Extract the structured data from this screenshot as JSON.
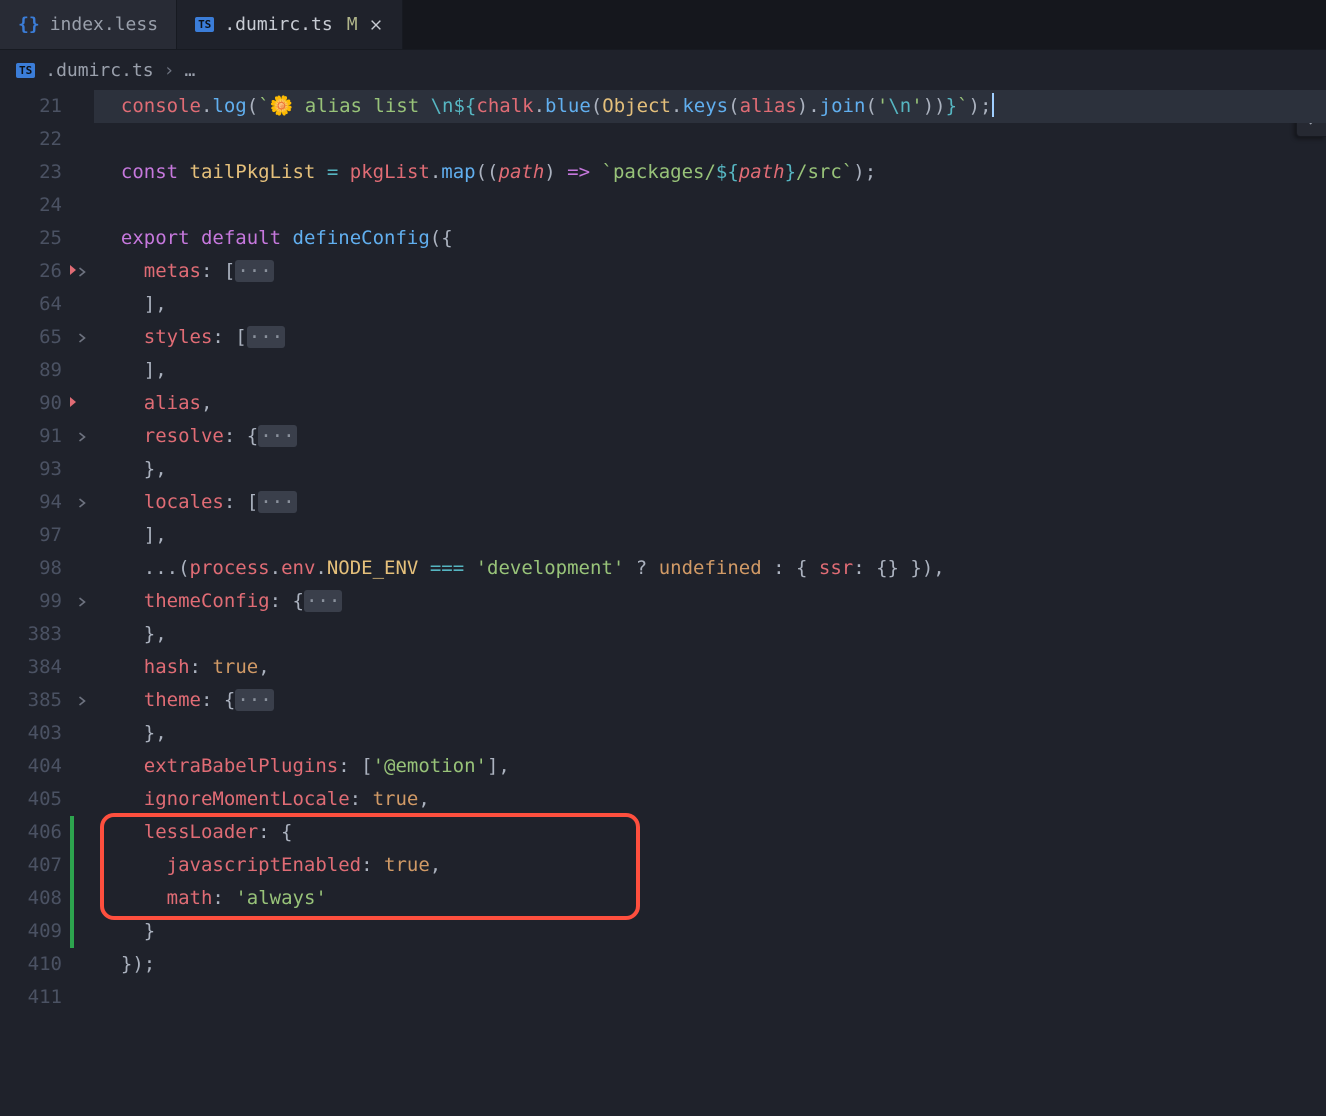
{
  "tabs": [
    {
      "name": "index.less",
      "icon": "braces",
      "modified": false,
      "active": false
    },
    {
      "name": ".dumirc.ts",
      "icon": "ts",
      "modified": true,
      "active": true
    }
  ],
  "breadcrumb": {
    "file": ".dumirc.ts",
    "trail": "…"
  },
  "annotation": {
    "present": true
  },
  "lines": [
    {
      "no": "21",
      "fold": "",
      "marker": "",
      "added": false,
      "tokens": [
        {
          "t": "  ",
          "c": ""
        },
        {
          "t": "console",
          "c": "t-var"
        },
        {
          "t": ".",
          "c": "t-punct"
        },
        {
          "t": "log",
          "c": "t-fn"
        },
        {
          "t": "(",
          "c": "t-punct"
        },
        {
          "t": "`",
          "c": "t-tpl"
        },
        {
          "t": "🌼 alias list ",
          "c": "t-tpl"
        },
        {
          "t": "\\n",
          "c": "t-esc"
        },
        {
          "t": "${",
          "c": "t-esc"
        },
        {
          "t": "chalk",
          "c": "t-var"
        },
        {
          "t": ".",
          "c": "t-punct"
        },
        {
          "t": "blue",
          "c": "t-fn"
        },
        {
          "t": "(",
          "c": "t-punct"
        },
        {
          "t": "Object",
          "c": "t-yellow"
        },
        {
          "t": ".",
          "c": "t-punct"
        },
        {
          "t": "keys",
          "c": "t-fn"
        },
        {
          "t": "(",
          "c": "t-punct"
        },
        {
          "t": "alias",
          "c": "t-var"
        },
        {
          "t": ")",
          "c": "t-punct"
        },
        {
          "t": ".",
          "c": "t-punct"
        },
        {
          "t": "join",
          "c": "t-fn"
        },
        {
          "t": "(",
          "c": "t-punct"
        },
        {
          "t": "'",
          "c": "t-str"
        },
        {
          "t": "\\n",
          "c": "t-esc"
        },
        {
          "t": "'",
          "c": "t-str"
        },
        {
          "t": ")",
          "c": "t-punct"
        },
        {
          "t": ")",
          "c": "t-punct"
        },
        {
          "t": "}",
          "c": "t-esc"
        },
        {
          "t": "`",
          "c": "t-tpl"
        },
        {
          "t": ")",
          "c": "t-punct"
        },
        {
          "t": ";",
          "c": "t-punct"
        }
      ],
      "hl": true,
      "caret": true
    },
    {
      "no": "22",
      "fold": "",
      "marker": "",
      "added": false,
      "tokens": [],
      "hl": false
    },
    {
      "no": "23",
      "fold": "",
      "marker": "",
      "added": false,
      "tokens": [
        {
          "t": "  ",
          "c": ""
        },
        {
          "t": "const",
          "c": "t-kw"
        },
        {
          "t": " ",
          "c": ""
        },
        {
          "t": "tailPkgList",
          "c": "t-yellow"
        },
        {
          "t": " ",
          "c": ""
        },
        {
          "t": "=",
          "c": "t-op"
        },
        {
          "t": " ",
          "c": ""
        },
        {
          "t": "pkgList",
          "c": "t-var"
        },
        {
          "t": ".",
          "c": "t-punct"
        },
        {
          "t": "map",
          "c": "t-fn"
        },
        {
          "t": "((",
          "c": "t-punct"
        },
        {
          "t": "path",
          "c": "t-param"
        },
        {
          "t": ") ",
          "c": "t-punct"
        },
        {
          "t": "=>",
          "c": "t-arrow"
        },
        {
          "t": " ",
          "c": ""
        },
        {
          "t": "`",
          "c": "t-tpl"
        },
        {
          "t": "packages/",
          "c": "t-tpl"
        },
        {
          "t": "${",
          "c": "t-esc"
        },
        {
          "t": "path",
          "c": "t-param"
        },
        {
          "t": "}",
          "c": "t-esc"
        },
        {
          "t": "/src",
          "c": "t-tpl"
        },
        {
          "t": "`",
          "c": "t-tpl"
        },
        {
          "t": ")",
          "c": "t-punct"
        },
        {
          "t": ";",
          "c": "t-punct"
        }
      ],
      "hl": false
    },
    {
      "no": "24",
      "fold": "",
      "marker": "",
      "added": false,
      "tokens": [],
      "hl": false
    },
    {
      "no": "25",
      "fold": "",
      "marker": "",
      "added": false,
      "tokens": [
        {
          "t": "  ",
          "c": ""
        },
        {
          "t": "export",
          "c": "t-kw"
        },
        {
          "t": " ",
          "c": ""
        },
        {
          "t": "default",
          "c": "t-kw"
        },
        {
          "t": " ",
          "c": ""
        },
        {
          "t": "defineConfig",
          "c": "t-fn"
        },
        {
          "t": "({",
          "c": "t-punct"
        }
      ],
      "hl": false
    },
    {
      "no": "26",
      "fold": ">",
      "marker": "red",
      "added": false,
      "tokens": [
        {
          "t": "    ",
          "c": ""
        },
        {
          "t": "metas",
          "c": "t-prop"
        },
        {
          "t": ":",
          "c": "t-punct"
        },
        {
          "t": " [",
          "c": "t-punct"
        },
        {
          "t": "···",
          "c": "fold-dots"
        }
      ],
      "hl": false
    },
    {
      "no": "64",
      "fold": "",
      "marker": "",
      "added": false,
      "tokens": [
        {
          "t": "    ]",
          "c": "t-punct"
        },
        {
          "t": ",",
          "c": "t-punct"
        }
      ],
      "hl": false
    },
    {
      "no": "65",
      "fold": ">",
      "marker": "",
      "added": false,
      "tokens": [
        {
          "t": "    ",
          "c": ""
        },
        {
          "t": "styles",
          "c": "t-prop"
        },
        {
          "t": ":",
          "c": "t-punct"
        },
        {
          "t": " [",
          "c": "t-punct"
        },
        {
          "t": "···",
          "c": "fold-dots"
        }
      ],
      "hl": false
    },
    {
      "no": "89",
      "fold": "",
      "marker": "",
      "added": false,
      "tokens": [
        {
          "t": "    ]",
          "c": "t-punct"
        },
        {
          "t": ",",
          "c": "t-punct"
        }
      ],
      "hl": false
    },
    {
      "no": "90",
      "fold": "",
      "marker": "red",
      "added": false,
      "tokens": [
        {
          "t": "    ",
          "c": ""
        },
        {
          "t": "alias",
          "c": "t-var"
        },
        {
          "t": ",",
          "c": "t-punct"
        }
      ],
      "hl": false
    },
    {
      "no": "91",
      "fold": ">",
      "marker": "",
      "added": false,
      "tokens": [
        {
          "t": "    ",
          "c": ""
        },
        {
          "t": "resolve",
          "c": "t-prop"
        },
        {
          "t": ":",
          "c": "t-punct"
        },
        {
          "t": " {",
          "c": "t-punct"
        },
        {
          "t": "···",
          "c": "fold-dots"
        }
      ],
      "hl": false
    },
    {
      "no": "93",
      "fold": "",
      "marker": "",
      "added": false,
      "tokens": [
        {
          "t": "    }",
          "c": "t-punct"
        },
        {
          "t": ",",
          "c": "t-punct"
        }
      ],
      "hl": false
    },
    {
      "no": "94",
      "fold": ">",
      "marker": "",
      "added": false,
      "tokens": [
        {
          "t": "    ",
          "c": ""
        },
        {
          "t": "locales",
          "c": "t-prop"
        },
        {
          "t": ":",
          "c": "t-punct"
        },
        {
          "t": " [",
          "c": "t-punct"
        },
        {
          "t": "···",
          "c": "fold-dots"
        }
      ],
      "hl": false
    },
    {
      "no": "97",
      "fold": "",
      "marker": "",
      "added": false,
      "tokens": [
        {
          "t": "    ]",
          "c": "t-punct"
        },
        {
          "t": ",",
          "c": "t-punct"
        }
      ],
      "hl": false
    },
    {
      "no": "98",
      "fold": "",
      "marker": "",
      "added": false,
      "tokens": [
        {
          "t": "    ",
          "c": ""
        },
        {
          "t": "...",
          "c": "t-punct"
        },
        {
          "t": "(",
          "c": "t-punct"
        },
        {
          "t": "process",
          "c": "t-var"
        },
        {
          "t": ".",
          "c": "t-punct"
        },
        {
          "t": "env",
          "c": "t-var"
        },
        {
          "t": ".",
          "c": "t-punct"
        },
        {
          "t": "NODE_ENV",
          "c": "t-yellow"
        },
        {
          "t": " ",
          "c": ""
        },
        {
          "t": "===",
          "c": "t-op"
        },
        {
          "t": " ",
          "c": ""
        },
        {
          "t": "'development'",
          "c": "t-str"
        },
        {
          "t": " ",
          "c": ""
        },
        {
          "t": "?",
          "c": "t-punct"
        },
        {
          "t": " ",
          "c": ""
        },
        {
          "t": "undefined",
          "c": "t-const"
        },
        {
          "t": " ",
          "c": ""
        },
        {
          "t": ":",
          "c": "t-punct"
        },
        {
          "t": " { ",
          "c": "t-punct"
        },
        {
          "t": "ssr",
          "c": "t-prop"
        },
        {
          "t": ":",
          "c": "t-punct"
        },
        {
          "t": " {} })",
          "c": "t-punct"
        },
        {
          "t": ",",
          "c": "t-punct"
        }
      ],
      "hl": false
    },
    {
      "no": "99",
      "fold": ">",
      "marker": "",
      "added": false,
      "tokens": [
        {
          "t": "    ",
          "c": ""
        },
        {
          "t": "themeConfig",
          "c": "t-prop"
        },
        {
          "t": ":",
          "c": "t-punct"
        },
        {
          "t": " {",
          "c": "t-punct"
        },
        {
          "t": "···",
          "c": "fold-dots"
        }
      ],
      "hl": false
    },
    {
      "no": "383",
      "fold": "",
      "marker": "",
      "added": false,
      "tokens": [
        {
          "t": "    }",
          "c": "t-punct"
        },
        {
          "t": ",",
          "c": "t-punct"
        }
      ],
      "hl": false
    },
    {
      "no": "384",
      "fold": "",
      "marker": "",
      "added": false,
      "tokens": [
        {
          "t": "    ",
          "c": ""
        },
        {
          "t": "hash",
          "c": "t-prop"
        },
        {
          "t": ":",
          "c": "t-punct"
        },
        {
          "t": " ",
          "c": ""
        },
        {
          "t": "true",
          "c": "t-const"
        },
        {
          "t": ",",
          "c": "t-punct"
        }
      ],
      "hl": false
    },
    {
      "no": "385",
      "fold": ">",
      "marker": "",
      "added": false,
      "tokens": [
        {
          "t": "    ",
          "c": ""
        },
        {
          "t": "theme",
          "c": "t-prop"
        },
        {
          "t": ":",
          "c": "t-punct"
        },
        {
          "t": " {",
          "c": "t-punct"
        },
        {
          "t": "···",
          "c": "fold-dots"
        }
      ],
      "hl": false
    },
    {
      "no": "403",
      "fold": "",
      "marker": "",
      "added": false,
      "tokens": [
        {
          "t": "    }",
          "c": "t-punct"
        },
        {
          "t": ",",
          "c": "t-punct"
        }
      ],
      "hl": false
    },
    {
      "no": "404",
      "fold": "",
      "marker": "",
      "added": false,
      "tokens": [
        {
          "t": "    ",
          "c": ""
        },
        {
          "t": "extraBabelPlugins",
          "c": "t-prop"
        },
        {
          "t": ":",
          "c": "t-punct"
        },
        {
          "t": " [",
          "c": "t-punct"
        },
        {
          "t": "'@emotion'",
          "c": "t-str"
        },
        {
          "t": "]",
          "c": "t-punct"
        },
        {
          "t": ",",
          "c": "t-punct"
        }
      ],
      "hl": false
    },
    {
      "no": "405",
      "fold": "",
      "marker": "",
      "added": false,
      "tokens": [
        {
          "t": "    ",
          "c": ""
        },
        {
          "t": "ignoreMomentLocale",
          "c": "t-prop"
        },
        {
          "t": ":",
          "c": "t-punct"
        },
        {
          "t": " ",
          "c": ""
        },
        {
          "t": "true",
          "c": "t-const"
        },
        {
          "t": ",",
          "c": "t-punct"
        }
      ],
      "hl": false
    },
    {
      "no": "406",
      "fold": "",
      "marker": "",
      "added": true,
      "tokens": [
        {
          "t": "    ",
          "c": ""
        },
        {
          "t": "lessLoader",
          "c": "t-prop"
        },
        {
          "t": ":",
          "c": "t-punct"
        },
        {
          "t": " {",
          "c": "t-punct"
        }
      ],
      "hl": false
    },
    {
      "no": "407",
      "fold": "",
      "marker": "",
      "added": true,
      "tokens": [
        {
          "t": "      ",
          "c": ""
        },
        {
          "t": "javascriptEnabled",
          "c": "t-prop"
        },
        {
          "t": ":",
          "c": "t-punct"
        },
        {
          "t": " ",
          "c": ""
        },
        {
          "t": "true",
          "c": "t-const"
        },
        {
          "t": ",",
          "c": "t-punct"
        }
      ],
      "hl": false
    },
    {
      "no": "408",
      "fold": "",
      "marker": "",
      "added": true,
      "tokens": [
        {
          "t": "      ",
          "c": ""
        },
        {
          "t": "math",
          "c": "t-prop"
        },
        {
          "t": ":",
          "c": "t-punct"
        },
        {
          "t": " ",
          "c": ""
        },
        {
          "t": "'always'",
          "c": "t-str"
        }
      ],
      "hl": false
    },
    {
      "no": "409",
      "fold": "",
      "marker": "",
      "added": true,
      "tokens": [
        {
          "t": "    }",
          "c": "t-punct"
        }
      ],
      "hl": false
    },
    {
      "no": "410",
      "fold": "",
      "marker": "",
      "added": false,
      "tokens": [
        {
          "t": "  })",
          "c": "t-punct"
        },
        {
          "t": ";",
          "c": "t-punct"
        }
      ],
      "hl": false
    },
    {
      "no": "411",
      "fold": "",
      "marker": "",
      "added": false,
      "tokens": [],
      "hl": false
    }
  ]
}
